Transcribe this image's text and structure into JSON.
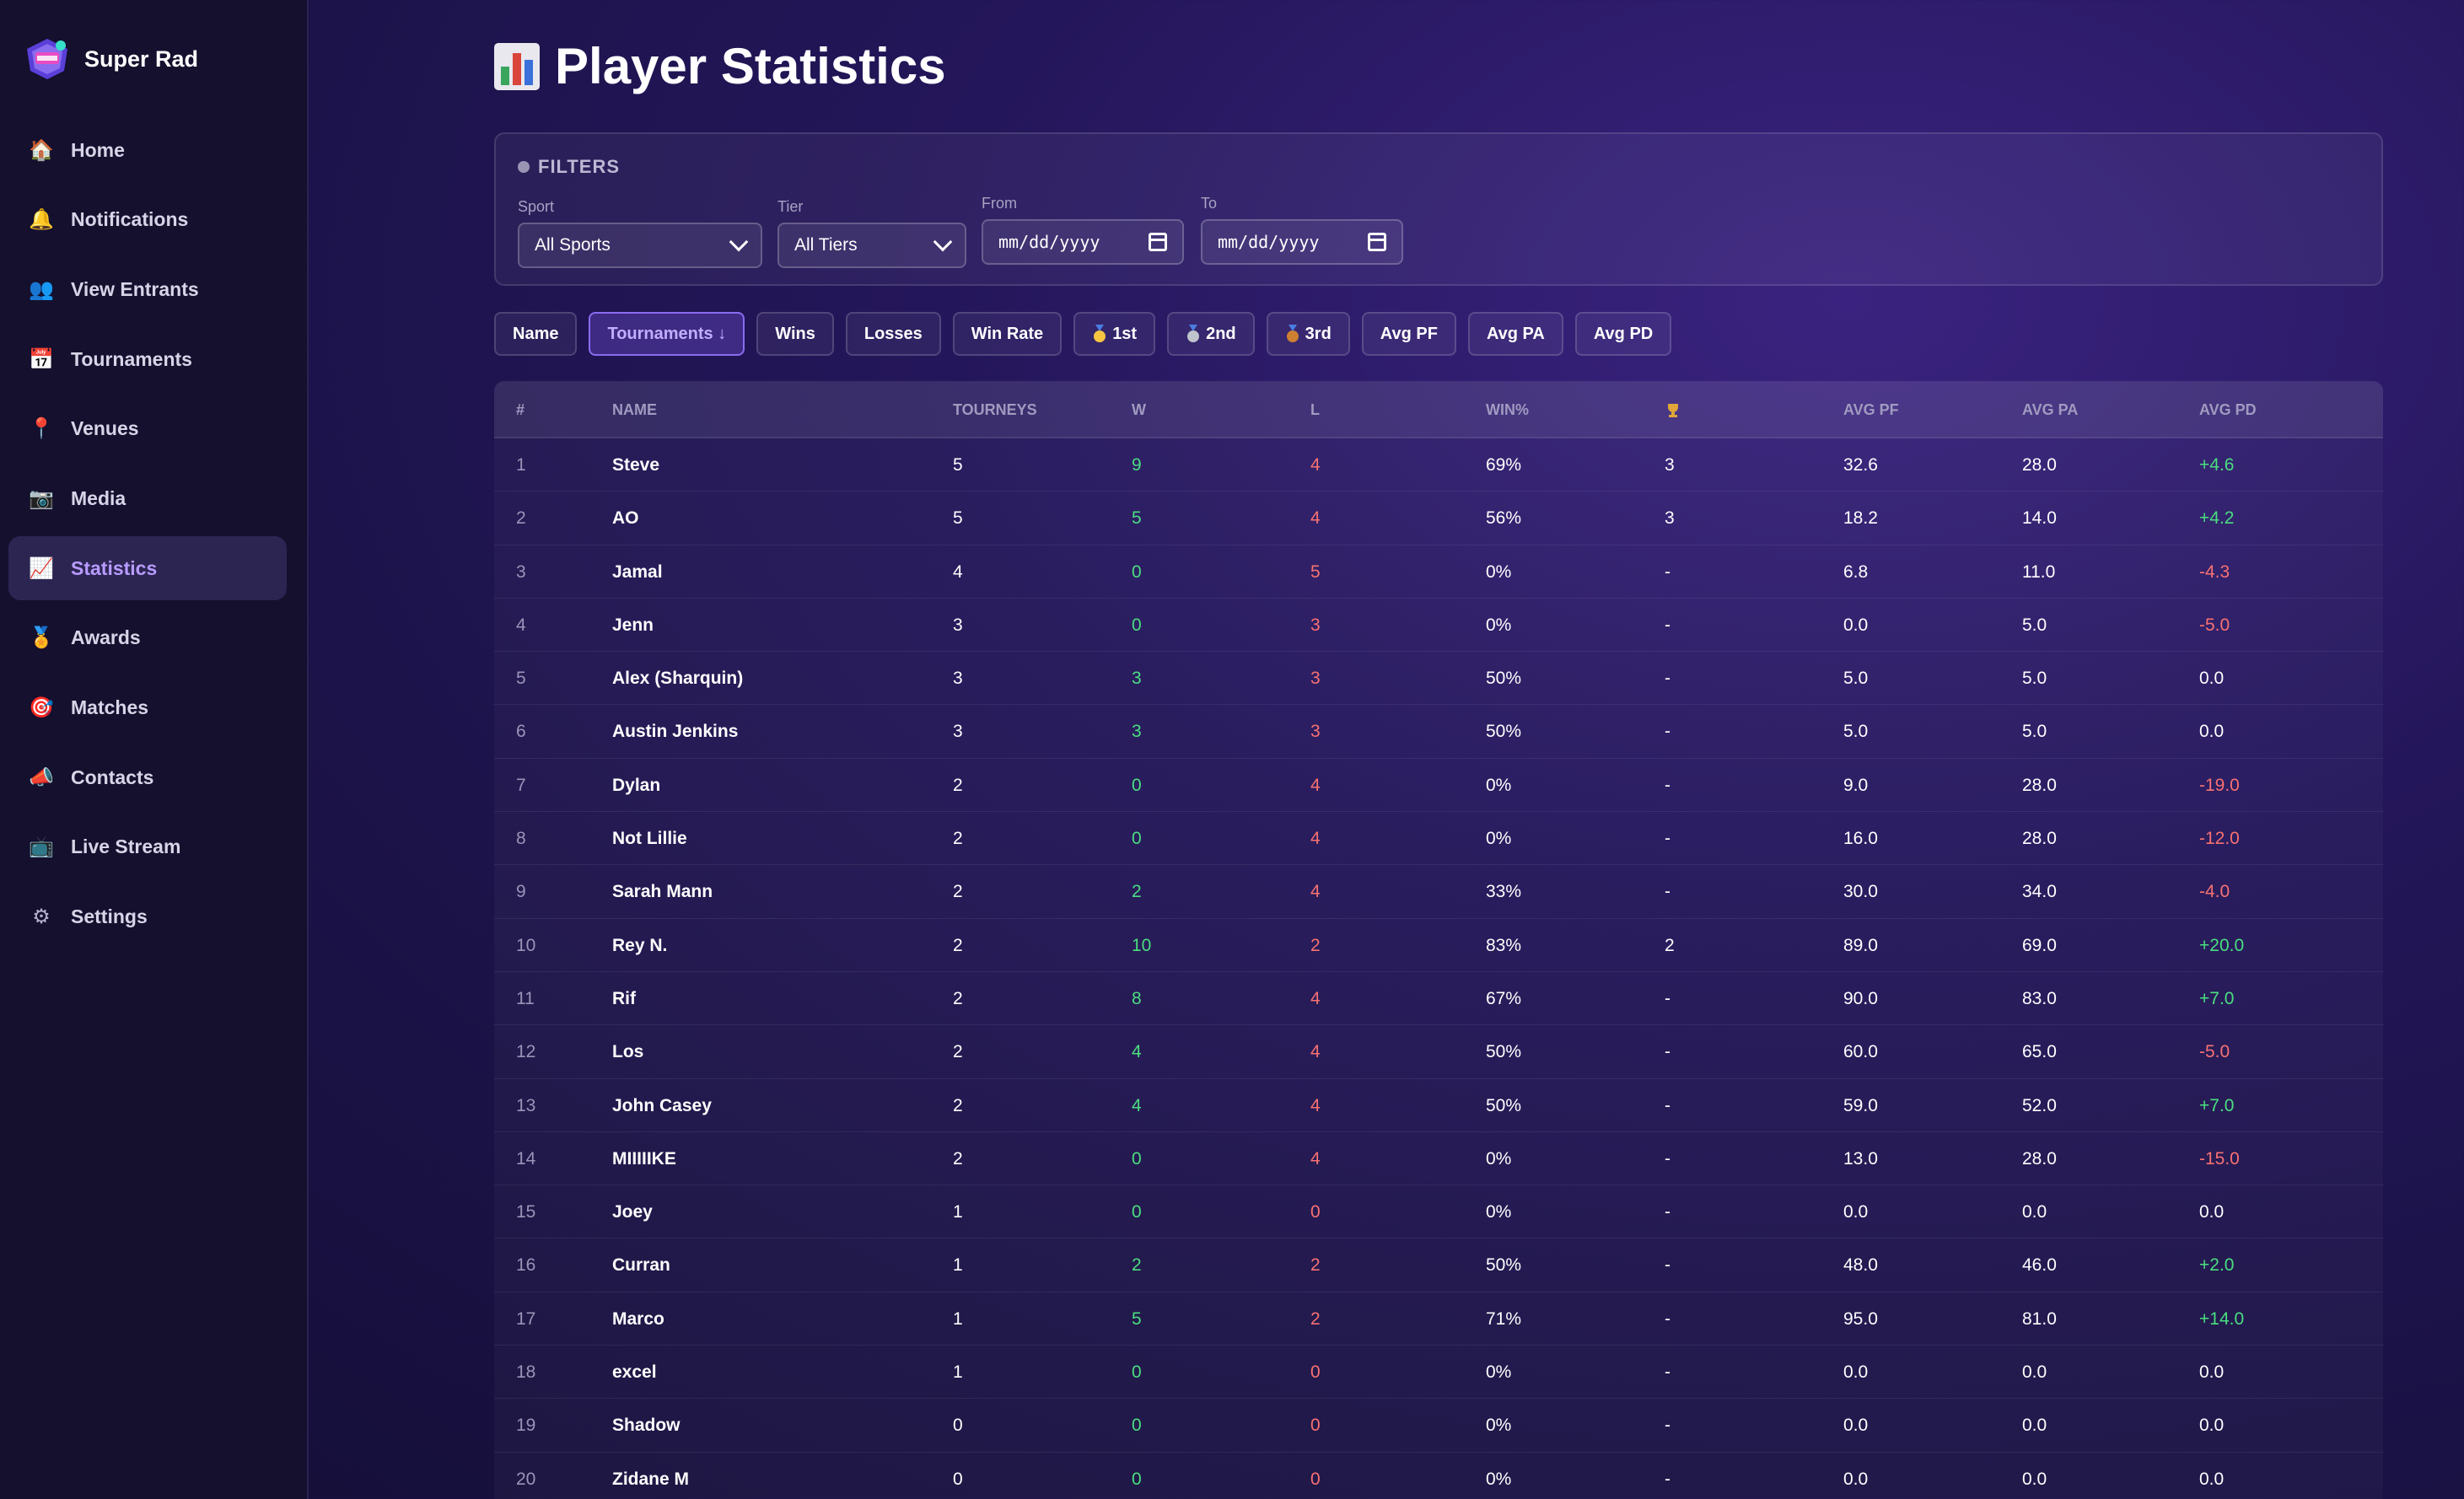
{
  "brand": {
    "name": "Super Rad"
  },
  "nav": [
    {
      "label": "Home",
      "icon": "house-icon",
      "glyph": "🏠"
    },
    {
      "label": "Notifications",
      "icon": "bell-icon",
      "glyph": "🔔"
    },
    {
      "label": "View Entrants",
      "icon": "people-icon",
      "glyph": "👥"
    },
    {
      "label": "Tournaments",
      "icon": "calendar-icon",
      "glyph": "📅"
    },
    {
      "label": "Venues",
      "icon": "pin-icon",
      "glyph": "📍"
    },
    {
      "label": "Media",
      "icon": "camera-icon",
      "glyph": "📷"
    },
    {
      "label": "Statistics",
      "icon": "chart-icon",
      "glyph": "📈",
      "active": true
    },
    {
      "label": "Awards",
      "icon": "medal-icon",
      "glyph": "🏅"
    },
    {
      "label": "Matches",
      "icon": "target-icon",
      "glyph": "🎯"
    },
    {
      "label": "Contacts",
      "icon": "megaphone-icon",
      "glyph": "📣"
    },
    {
      "label": "Live Stream",
      "icon": "tv-icon",
      "glyph": "📺"
    },
    {
      "label": "Settings",
      "icon": "gear-icon",
      "glyph": "⚙"
    }
  ],
  "page": {
    "title": "Player Statistics"
  },
  "filters": {
    "title": "FILTERS",
    "sport": {
      "label": "Sport",
      "value": "All Sports"
    },
    "tier": {
      "label": "Tier",
      "value": "All Tiers"
    },
    "from": {
      "label": "From",
      "value": "mm/dd/yyyy"
    },
    "to": {
      "label": "To",
      "value": "mm/dd/yyyy"
    }
  },
  "sort_buttons": [
    {
      "label": "Name"
    },
    {
      "label": "Tournaments ↓",
      "active": true
    },
    {
      "label": "Wins"
    },
    {
      "label": "Losses"
    },
    {
      "label": "Win Rate"
    },
    {
      "label": "1st",
      "medal": "gold"
    },
    {
      "label": "2nd",
      "medal": "silver"
    },
    {
      "label": "3rd",
      "medal": "bronze"
    },
    {
      "label": "Avg PF"
    },
    {
      "label": "Avg PA"
    },
    {
      "label": "Avg PD"
    }
  ],
  "table": {
    "headers": [
      "#",
      "NAME",
      "TOURNEYS",
      "W",
      "L",
      "WIN%",
      "",
      "AVG PF",
      "AVG PA",
      "AVG PD"
    ],
    "rows": [
      [
        "1",
        "Steve",
        "5",
        "9",
        "4",
        "69%",
        "3",
        "32.6",
        "28.0",
        "+4.6"
      ],
      [
        "2",
        "AO",
        "5",
        "5",
        "4",
        "56%",
        "3",
        "18.2",
        "14.0",
        "+4.2"
      ],
      [
        "3",
        "Jamal",
        "4",
        "0",
        "5",
        "0%",
        "-",
        "6.8",
        "11.0",
        "-4.3"
      ],
      [
        "4",
        "Jenn",
        "3",
        "0",
        "3",
        "0%",
        "-",
        "0.0",
        "5.0",
        "-5.0"
      ],
      [
        "5",
        "Alex (Sharquin)",
        "3",
        "3",
        "3",
        "50%",
        "-",
        "5.0",
        "5.0",
        "0.0"
      ],
      [
        "6",
        "Austin Jenkins",
        "3",
        "3",
        "3",
        "50%",
        "-",
        "5.0",
        "5.0",
        "0.0"
      ],
      [
        "7",
        "Dylan",
        "2",
        "0",
        "4",
        "0%",
        "-",
        "9.0",
        "28.0",
        "-19.0"
      ],
      [
        "8",
        "Not Lillie",
        "2",
        "0",
        "4",
        "0%",
        "-",
        "16.0",
        "28.0",
        "-12.0"
      ],
      [
        "9",
        "Sarah Mann",
        "2",
        "2",
        "4",
        "33%",
        "-",
        "30.0",
        "34.0",
        "-4.0"
      ],
      [
        "10",
        "Rey N.",
        "2",
        "10",
        "2",
        "83%",
        "2",
        "89.0",
        "69.0",
        "+20.0"
      ],
      [
        "11",
        "Rif",
        "2",
        "8",
        "4",
        "67%",
        "-",
        "90.0",
        "83.0",
        "+7.0"
      ],
      [
        "12",
        "Los",
        "2",
        "4",
        "4",
        "50%",
        "-",
        "60.0",
        "65.0",
        "-5.0"
      ],
      [
        "13",
        "John Casey",
        "2",
        "4",
        "4",
        "50%",
        "-",
        "59.0",
        "52.0",
        "+7.0"
      ],
      [
        "14",
        "MIIIIIKE",
        "2",
        "0",
        "4",
        "0%",
        "-",
        "13.0",
        "28.0",
        "-15.0"
      ],
      [
        "15",
        "Joey",
        "1",
        "0",
        "0",
        "0%",
        "-",
        "0.0",
        "0.0",
        "0.0"
      ],
      [
        "16",
        "Curran",
        "1",
        "2",
        "2",
        "50%",
        "-",
        "48.0",
        "46.0",
        "+2.0"
      ],
      [
        "17",
        "Marco",
        "1",
        "5",
        "2",
        "71%",
        "-",
        "95.0",
        "81.0",
        "+14.0"
      ],
      [
        "18",
        "excel",
        "1",
        "0",
        "0",
        "0%",
        "-",
        "0.0",
        "0.0",
        "0.0"
      ],
      [
        "19",
        "Shadow",
        "0",
        "0",
        "0",
        "0%",
        "-",
        "0.0",
        "0.0",
        "0.0"
      ],
      [
        "20",
        "Zidane M",
        "0",
        "0",
        "0",
        "0%",
        "-",
        "0.0",
        "0.0",
        "0.0"
      ]
    ]
  },
  "colors": {
    "positive": "#4ade80",
    "negative": "#f87171",
    "accent": "#b89bff"
  }
}
